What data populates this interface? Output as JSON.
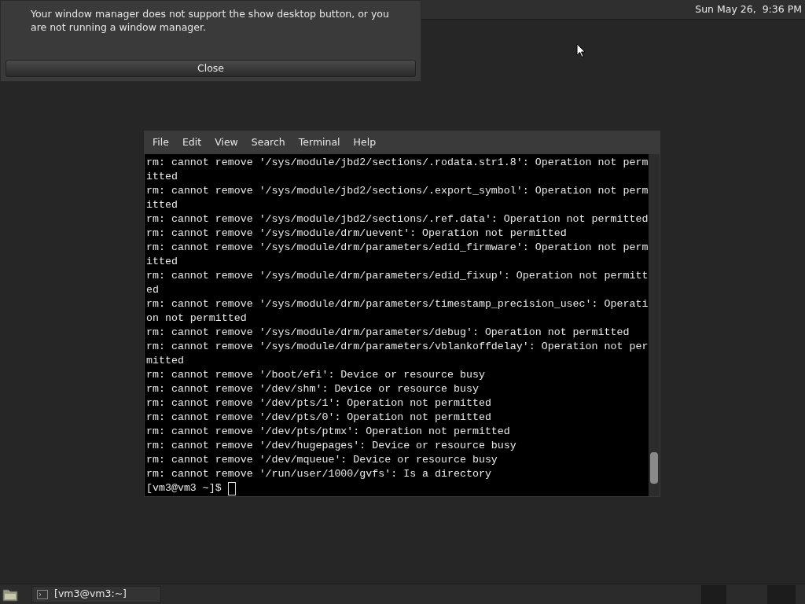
{
  "top_panel": {
    "clock": "Sun May 26,  9:36 PM"
  },
  "notification": {
    "message": "Your window manager does not support the show desktop button, or you are not running a window manager.",
    "button": "Close"
  },
  "terminal": {
    "menu": [
      "File",
      "Edit",
      "View",
      "Search",
      "Terminal",
      "Help"
    ],
    "lines": [
      "rm: cannot remove '/sys/module/jbd2/sections/.rodata.str1.8': Operation not perm",
      "itted",
      "rm: cannot remove '/sys/module/jbd2/sections/.export_symbol': Operation not perm",
      "itted",
      "rm: cannot remove '/sys/module/jbd2/sections/.ref.data': Operation not permitted",
      "rm: cannot remove '/sys/module/drm/uevent': Operation not permitted",
      "rm: cannot remove '/sys/module/drm/parameters/edid_firmware': Operation not perm",
      "itted",
      "rm: cannot remove '/sys/module/drm/parameters/edid_fixup': Operation not permitt",
      "ed",
      "rm: cannot remove '/sys/module/drm/parameters/timestamp_precision_usec': Operati",
      "on not permitted",
      "rm: cannot remove '/sys/module/drm/parameters/debug': Operation not permitted",
      "rm: cannot remove '/sys/module/drm/parameters/vblankoffdelay': Operation not per",
      "mitted",
      "rm: cannot remove '/boot/efi': Device or resource busy",
      "rm: cannot remove '/dev/shm': Device or resource busy",
      "rm: cannot remove '/dev/pts/1': Operation not permitted",
      "rm: cannot remove '/dev/pts/0': Operation not permitted",
      "rm: cannot remove '/dev/pts/ptmx': Operation not permitted",
      "rm: cannot remove '/dev/hugepages': Device or resource busy",
      "rm: cannot remove '/dev/mqueue': Device or resource busy",
      "rm: cannot remove '/run/user/1000/gvfs': Is a directory"
    ],
    "prompt": "[vm3@vm3 ~]$"
  },
  "taskbar": {
    "tasks": [
      {
        "label": "[vm3@vm3:~]",
        "selected": false
      }
    ]
  }
}
